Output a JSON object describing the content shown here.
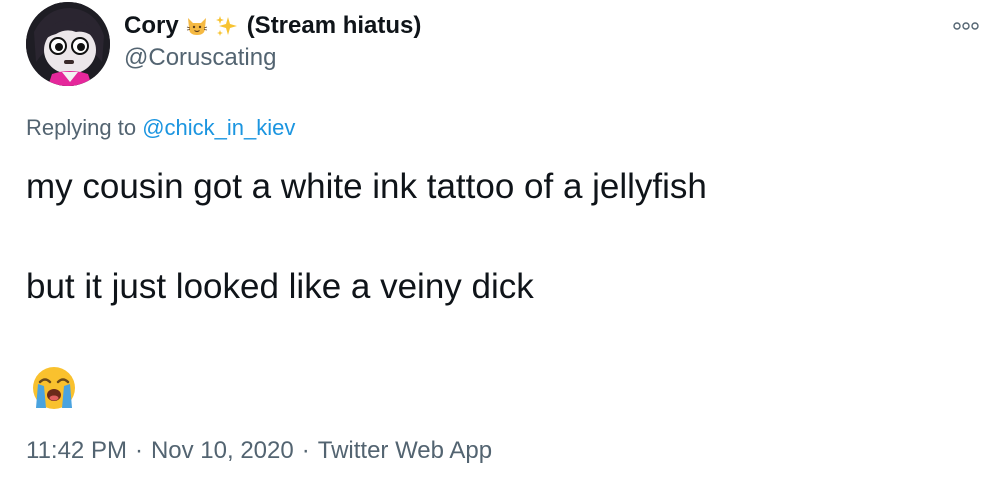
{
  "tweet": {
    "display_name": "Cory",
    "name_suffix": "(Stream hiatus)",
    "name_emojis": [
      "cat-face-emoji",
      "sparkles-emoji"
    ],
    "handle": "@Coruscating",
    "replying_prefix": "Replying to",
    "replying_to": "@chick_in_kiev",
    "text_line_1": "my cousin got a white ink tattoo of a jellyfish",
    "text_line_2": "but it just looked like a veiny dick",
    "trailing_emoji": "loudly-crying-face-emoji",
    "time": "11:42 PM",
    "date": "Nov 10, 2020",
    "source": "Twitter Web App",
    "separator": "·"
  },
  "colors": {
    "text_primary": "#0f1419",
    "text_secondary": "#536471",
    "link": "#1b95e0",
    "background": "#ffffff"
  },
  "icons": {
    "more": "more-options-icon"
  }
}
